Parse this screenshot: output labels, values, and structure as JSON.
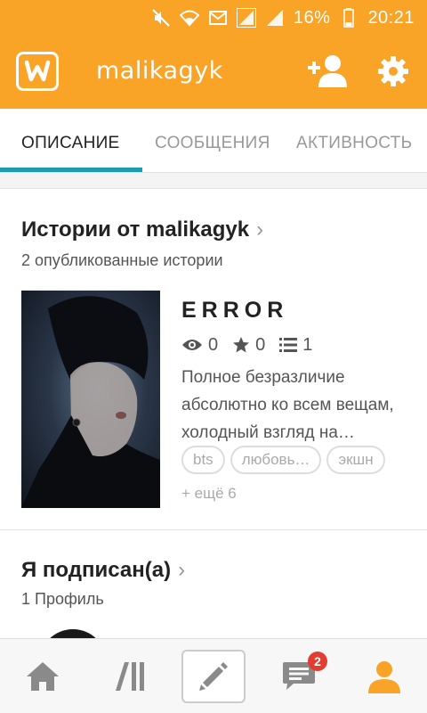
{
  "status_bar": {
    "battery": "16%",
    "time": "20:21",
    "icons": [
      "mute-icon",
      "wifi-icon",
      "mail-icon",
      "signal-icon",
      "signal-icon",
      "battery-icon"
    ]
  },
  "app_bar": {
    "title": "malikagyk",
    "logo_icon": "wattpad-logo",
    "actions": [
      "add-user-icon",
      "gear-icon"
    ],
    "colors": {
      "primary": "#f9a427"
    }
  },
  "tabs": [
    {
      "label": "ОПИСАНИЕ",
      "active": true
    },
    {
      "label": "СООБЩЕНИЯ",
      "active": false
    },
    {
      "label": "АКТИВНОСТЬ",
      "active": false
    }
  ],
  "tab_accent": "#1c9bb2",
  "stories": {
    "title": "Истории от malikagyk",
    "subtitle": "2 опубликованные истории",
    "featured": {
      "title": "ERROR",
      "views": "0",
      "votes": "0",
      "parts": "1",
      "description": "Полное безразличие абсолютно ко всем вещам, холодный взгляд на…",
      "tags": [
        "bts",
        "любовь…",
        "экшн"
      ],
      "more_tags": "+ ещё 6"
    }
  },
  "following": {
    "title": "Я подписан(а)",
    "subtitle": "1 Профиль"
  },
  "bottom_nav": {
    "items": [
      "home-icon",
      "library-icon",
      "write-icon",
      "messages-icon",
      "profile-icon"
    ],
    "messages_badge": "2",
    "active": "profile-icon"
  }
}
